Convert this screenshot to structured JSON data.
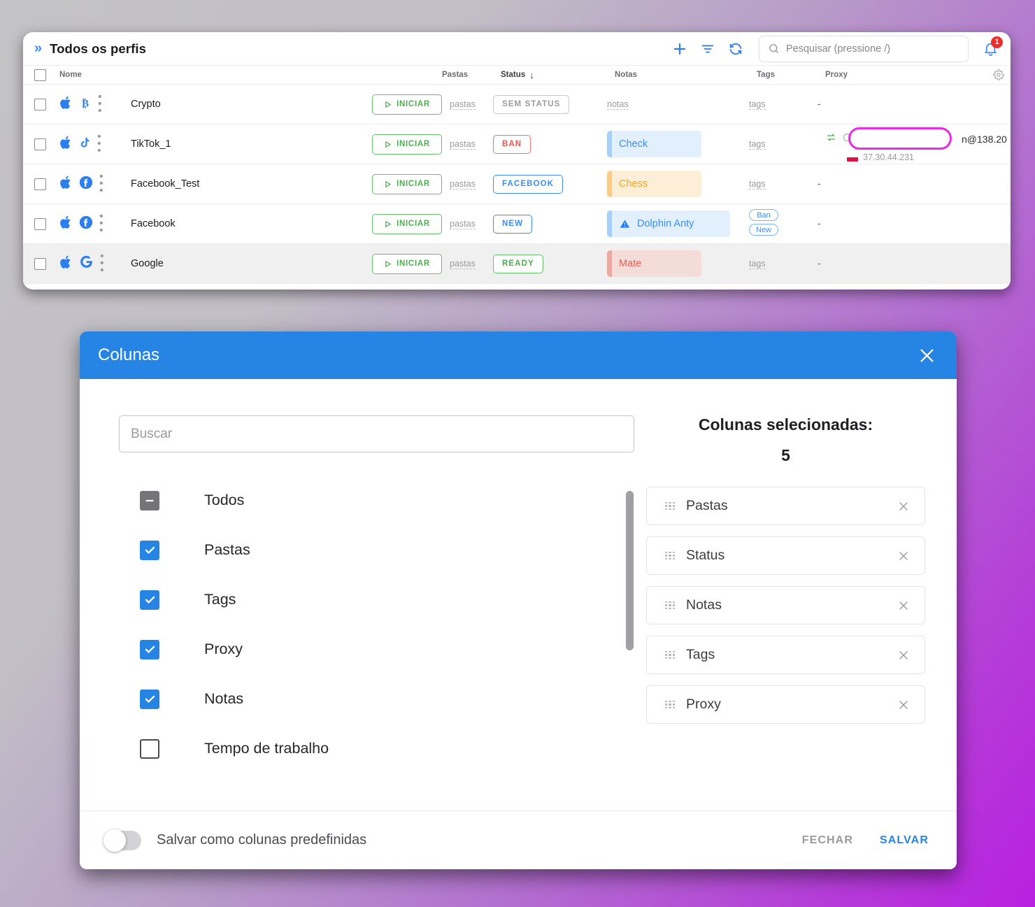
{
  "app": {
    "title": "Todos os perfis",
    "expand_icon": "chevron-double-right-icon",
    "toolbar": {
      "add": "add-icon",
      "filter": "filter-icon",
      "refresh": "refresh-icon",
      "search_placeholder": "Pesquisar (pressione /)",
      "notifications_count": "1"
    },
    "table": {
      "headers": {
        "name": "Nome",
        "pastas": "Pastas",
        "status": "Status",
        "status_sort": "↓",
        "notas": "Notas",
        "tags": "Tags",
        "proxy": "Proxy"
      },
      "rows": [
        {
          "name": "Crypto",
          "platform_icon": "bitcoin-icon",
          "os_icon": "apple-icon",
          "start": "INICIAR",
          "pastas": "pastas",
          "status": "SEM STATUS",
          "status_style": "gray",
          "notas": "notas",
          "notas_style": "link",
          "tags": "tags",
          "tags_style": "link",
          "proxy": "-"
        },
        {
          "name": "TikTok_1",
          "platform_icon": "tiktok-icon",
          "os_icon": "apple-icon",
          "start": "INICIAR",
          "pastas": "pastas",
          "status": "BAN",
          "status_style": "red",
          "notas": "Check",
          "notas_style": "blue",
          "tags": "tags",
          "tags_style": "link",
          "proxy": "n@138.20",
          "proxy_ip": "37.30.44.231",
          "proxy_flag": "poland-flag-icon",
          "highlighted": true
        },
        {
          "name": "Facebook_Test",
          "platform_icon": "facebook-icon",
          "os_icon": "apple-icon",
          "start": "INICIAR",
          "pastas": "pastas",
          "status": "FACEBOOK",
          "status_style": "blue",
          "notas": "Chess",
          "notas_style": "orange",
          "tags": "tags",
          "tags_style": "link",
          "proxy": "-"
        },
        {
          "name": "Facebook",
          "platform_icon": "facebook-icon",
          "os_icon": "apple-icon",
          "start": "INICIAR",
          "pastas": "pastas",
          "status": "NEW",
          "status_style": "blue",
          "notas": "Dolphin Anty",
          "notas_style": "blue",
          "notas_icon": "warning-icon",
          "tag_pills": [
            "Ban",
            "New"
          ],
          "proxy": "-"
        },
        {
          "name": "Google",
          "platform_icon": "google-icon",
          "os_icon": "apple-icon",
          "start": "INICIAR",
          "pastas": "pastas",
          "status": "READY",
          "status_style": "green",
          "notas": "Mate",
          "notas_style": "red",
          "tags": "tags",
          "tags_style": "link",
          "proxy": "-"
        }
      ]
    }
  },
  "modal": {
    "title": "Colunas",
    "close_icon": "close-icon",
    "search_placeholder": "Buscar",
    "options": [
      {
        "label": "Todos",
        "state": "mix"
      },
      {
        "label": "Pastas",
        "state": "on"
      },
      {
        "label": "Tags",
        "state": "on"
      },
      {
        "label": "Proxy",
        "state": "on"
      },
      {
        "label": "Notas",
        "state": "on"
      },
      {
        "label": "Tempo de trabalho",
        "state": "off"
      }
    ],
    "selected_title": "Colunas selecionadas:",
    "selected_count": "5",
    "selected": [
      "Pastas",
      "Status",
      "Notas",
      "Tags",
      "Proxy"
    ],
    "footer": {
      "toggle_label": "Salvar como colunas predefinidas",
      "toggle_on": false,
      "close": "FECHAR",
      "save": "SALVAR"
    }
  },
  "colors": {
    "accent_blue": "#2684e4",
    "green": "#4caf50",
    "red": "#f2534b",
    "highlight_magenta": "#ef25e8"
  }
}
